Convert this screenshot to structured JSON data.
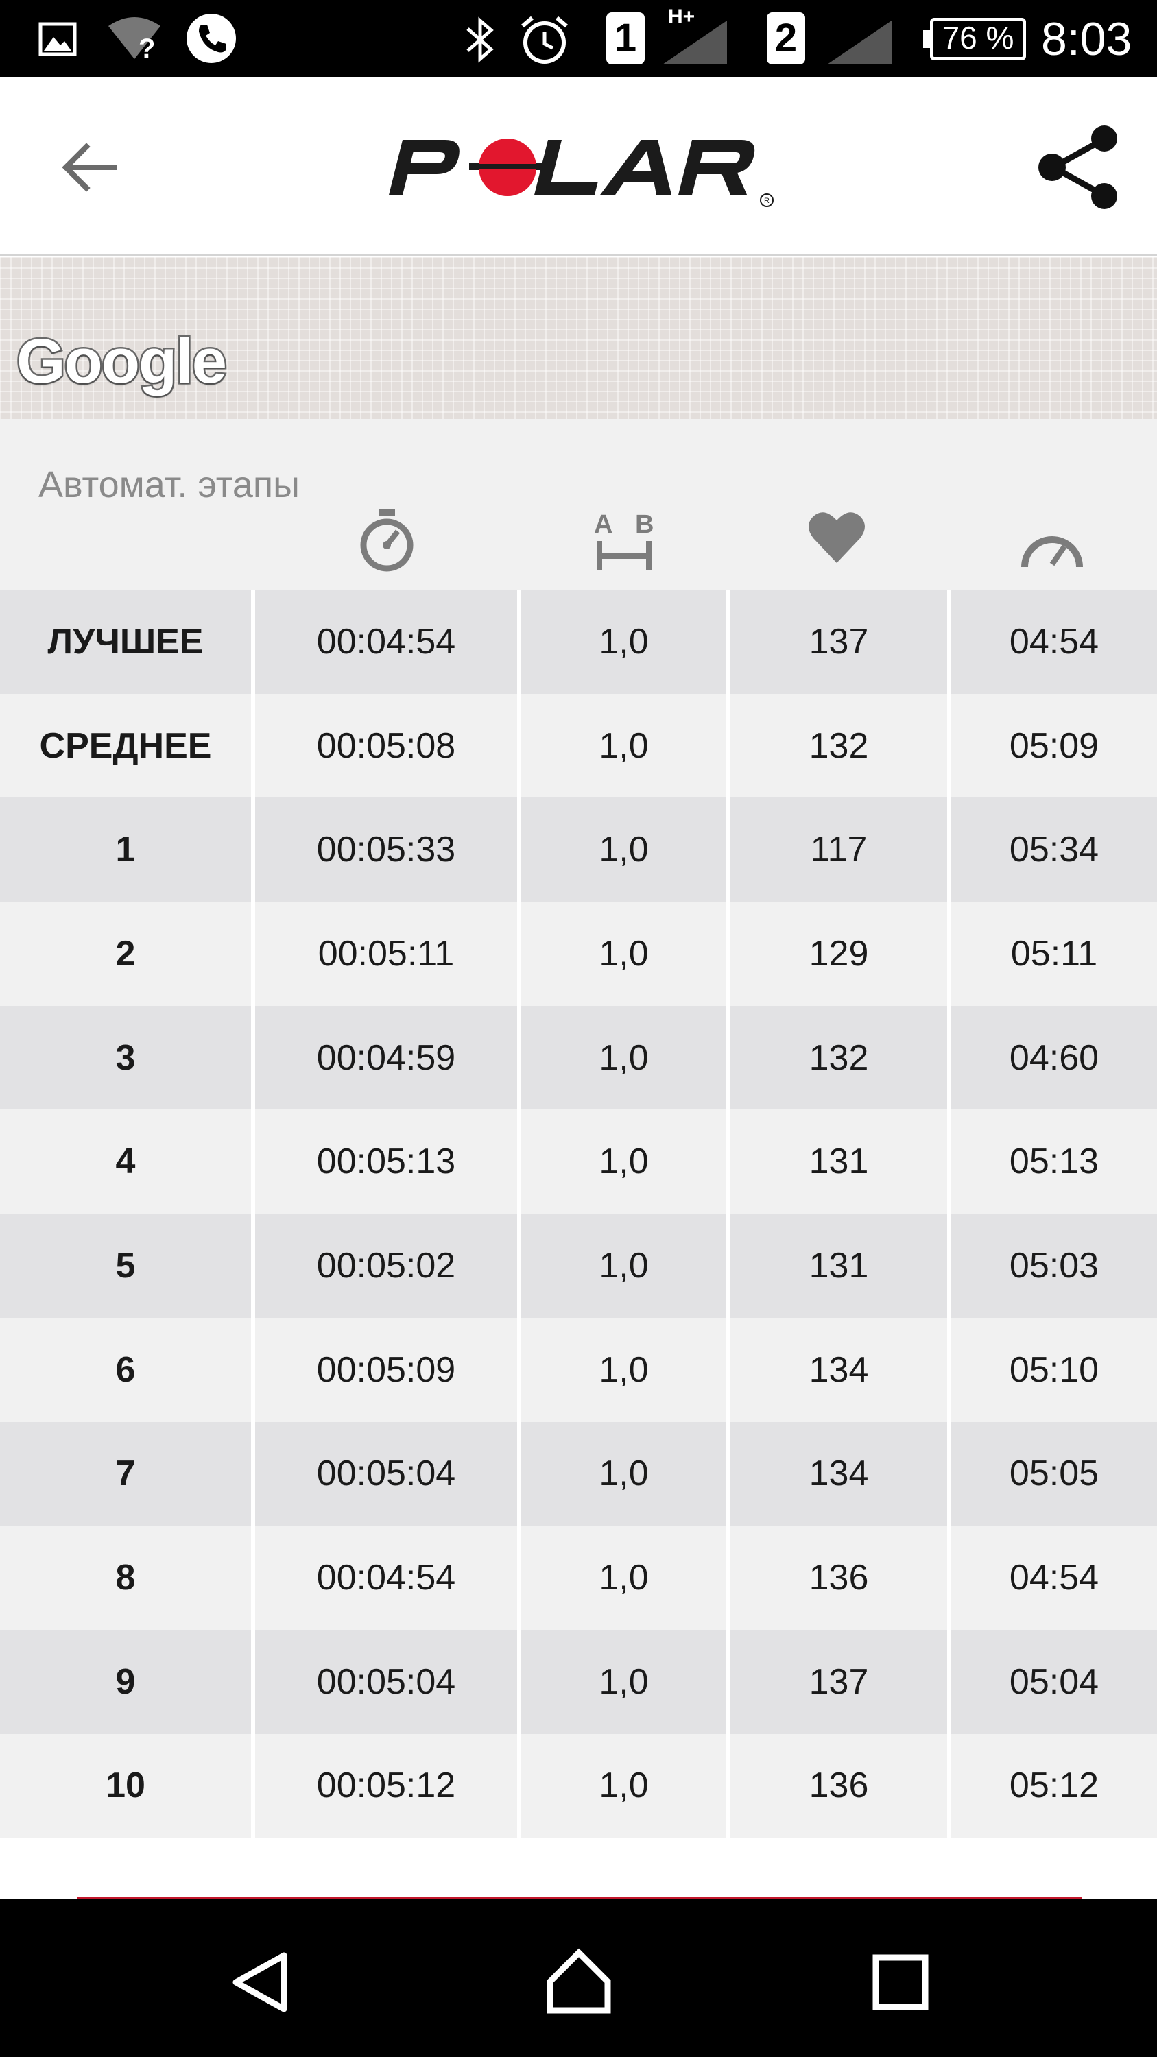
{
  "status_bar": {
    "sim1": "1",
    "sim2": "2",
    "network": "H+",
    "battery": "76 %",
    "time": "8:03",
    "icons": [
      "image-icon",
      "wifi-unknown-icon",
      "phone-icon",
      "bluetooth-icon",
      "alarm-icon",
      "signal-icon",
      "signal-icon",
      "battery-icon"
    ]
  },
  "app_bar": {
    "logo": "POLAR",
    "back_icon": "arrow-left-icon",
    "share_icon": "share-icon"
  },
  "map": {
    "attribution": "Google"
  },
  "laps": {
    "title": "Автомат. этапы",
    "column_icons": [
      "stopwatch-icon",
      "distance-ab-icon",
      "heart-icon",
      "speedometer-icon"
    ],
    "rows": [
      [
        "ЛУЧШЕЕ",
        "00:04:54",
        "1,0",
        "137",
        "04:54"
      ],
      [
        "СРЕДНЕЕ",
        "00:05:08",
        "1,0",
        "132",
        "05:09"
      ],
      [
        "1",
        "00:05:33",
        "1,0",
        "117",
        "05:34"
      ],
      [
        "2",
        "00:05:11",
        "1,0",
        "129",
        "05:11"
      ],
      [
        "3",
        "00:04:59",
        "1,0",
        "132",
        "04:60"
      ],
      [
        "4",
        "00:05:13",
        "1,0",
        "131",
        "05:13"
      ],
      [
        "5",
        "00:05:02",
        "1,0",
        "131",
        "05:03"
      ],
      [
        "6",
        "00:05:09",
        "1,0",
        "134",
        "05:10"
      ],
      [
        "7",
        "00:05:04",
        "1,0",
        "134",
        "05:05"
      ],
      [
        "8",
        "00:04:54",
        "1,0",
        "136",
        "04:54"
      ],
      [
        "9",
        "00:05:04",
        "1,0",
        "137",
        "05:04"
      ],
      [
        "10",
        "00:05:12",
        "1,0",
        "136",
        "05:12"
      ]
    ]
  },
  "nav_bar": {
    "icons": [
      "back-triangle-icon",
      "home-icon",
      "recents-icon"
    ]
  },
  "colors": {
    "brand_red": "#e2172e",
    "row_dark": "#e2e2e4",
    "row_light": "#f1f1f1"
  }
}
